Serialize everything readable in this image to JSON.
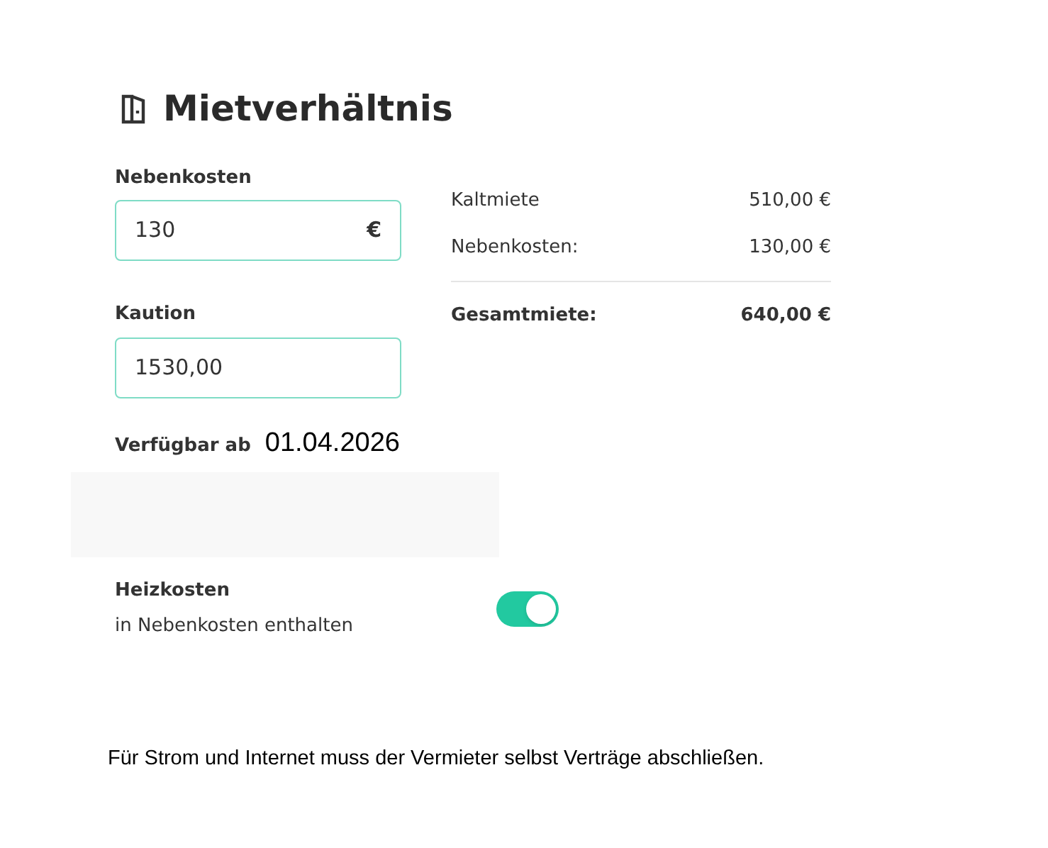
{
  "title": "Mietverhältnis",
  "fields": [
    {
      "label": "Nebenkosten",
      "value": "130",
      "suffix": "€"
    },
    {
      "label": "Kaution",
      "value": "1530,00"
    }
  ],
  "summary": {
    "rows": [
      {
        "label": "Kaltmiete",
        "value": "510,00 €"
      },
      {
        "label": "Nebenkosten:",
        "value": "130,00 €"
      }
    ],
    "total": {
      "label": "Gesamtmiete:",
      "value": "640,00 €"
    }
  },
  "available": {
    "label": "Verfügbar ab",
    "value": "01.04.2026"
  },
  "heating": {
    "label": "Heizkosten",
    "sublabel": "in Nebenkosten enthalten",
    "on": true
  },
  "note": "Für Strom und Internet muss der Vermieter selbst Verträge abschließen."
}
